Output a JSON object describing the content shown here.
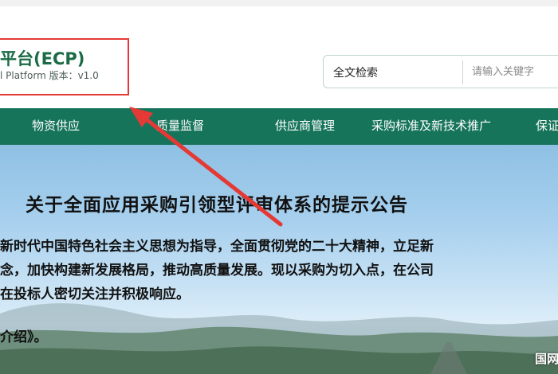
{
  "header": {
    "brand_title": "平台(ECP)",
    "brand_subtitle": "l Platform 版本：v1.0"
  },
  "search": {
    "type_label": "全文检索",
    "placeholder": "请输入关键字"
  },
  "nav": {
    "items": [
      {
        "label": "物资供应"
      },
      {
        "label": "质量监督"
      },
      {
        "label": "供应商管理"
      },
      {
        "label": "采购标准及新技术推广"
      },
      {
        "label": "保证"
      }
    ]
  },
  "notice": {
    "title": "关于全面应用采购引领型评审体系的提示公告",
    "lines": [
      "新时代中国特色社会主义思想为指导，全面贯彻党的二十大精神，立足新",
      "念，加快构建新发展格局，推动高质量发展。现以采购为切入点，在公司",
      "在投标人密切关注并积极响应。",
      "介绍》。"
    ],
    "corner_label": "国网"
  },
  "colors": {
    "brand_green": "#1b6b45",
    "nav_green": "#16745a",
    "highlight_red": "#e53935"
  }
}
